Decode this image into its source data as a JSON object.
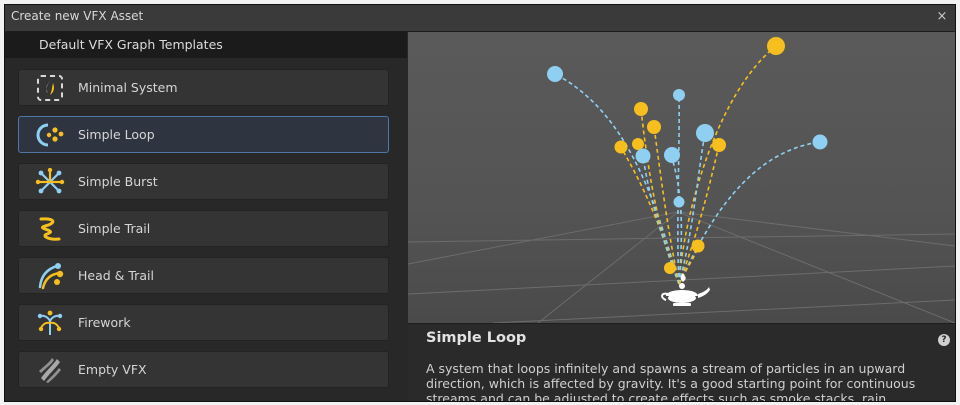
{
  "window": {
    "title": "Create new VFX Asset",
    "close_glyph": "×"
  },
  "left_panel": {
    "header": "Default VFX Graph Templates",
    "templates": [
      {
        "label": "Minimal System",
        "icon": "minimal-system-icon"
      },
      {
        "label": "Simple Loop",
        "icon": "simple-loop-icon",
        "selected": true
      },
      {
        "label": "Simple Burst",
        "icon": "simple-burst-icon"
      },
      {
        "label": "Simple Trail",
        "icon": "simple-trail-icon"
      },
      {
        "label": "Head & Trail",
        "icon": "head-and-trail-icon"
      },
      {
        "label": "Firework",
        "icon": "firework-icon"
      },
      {
        "label": "Empty VFX",
        "icon": "empty-vfx-icon"
      }
    ]
  },
  "details": {
    "title": "Simple Loop",
    "help_glyph": "?",
    "description": "A system that loops infinitely and spawns a stream of particles in an upward direction, which is affected by gravity. It's a good starting point for continuous streams and can be adjusted to create effects such as smoke stacks, rain, waterfalls, etc."
  },
  "colors": {
    "accent_blue": "#8fd0f2",
    "accent_yellow": "#f6bf1e",
    "selection_border": "#4e77a8",
    "panel_bg": "#282828"
  }
}
